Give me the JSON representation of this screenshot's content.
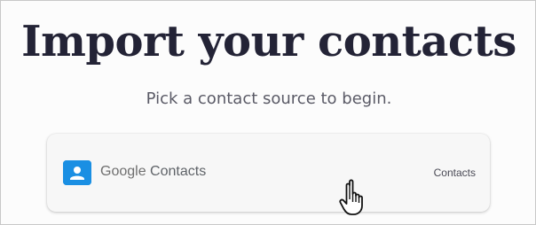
{
  "page": {
    "title": "Import your contacts",
    "subtitle": "Pick a contact source to begin."
  },
  "sources": [
    {
      "brand": "Google",
      "name": "Contacts",
      "category": "Contacts",
      "icon": "google-contacts-icon",
      "icon_color": "#1a8fe3"
    }
  ],
  "cursor": {
    "icon": "hand-pointer-icon"
  }
}
